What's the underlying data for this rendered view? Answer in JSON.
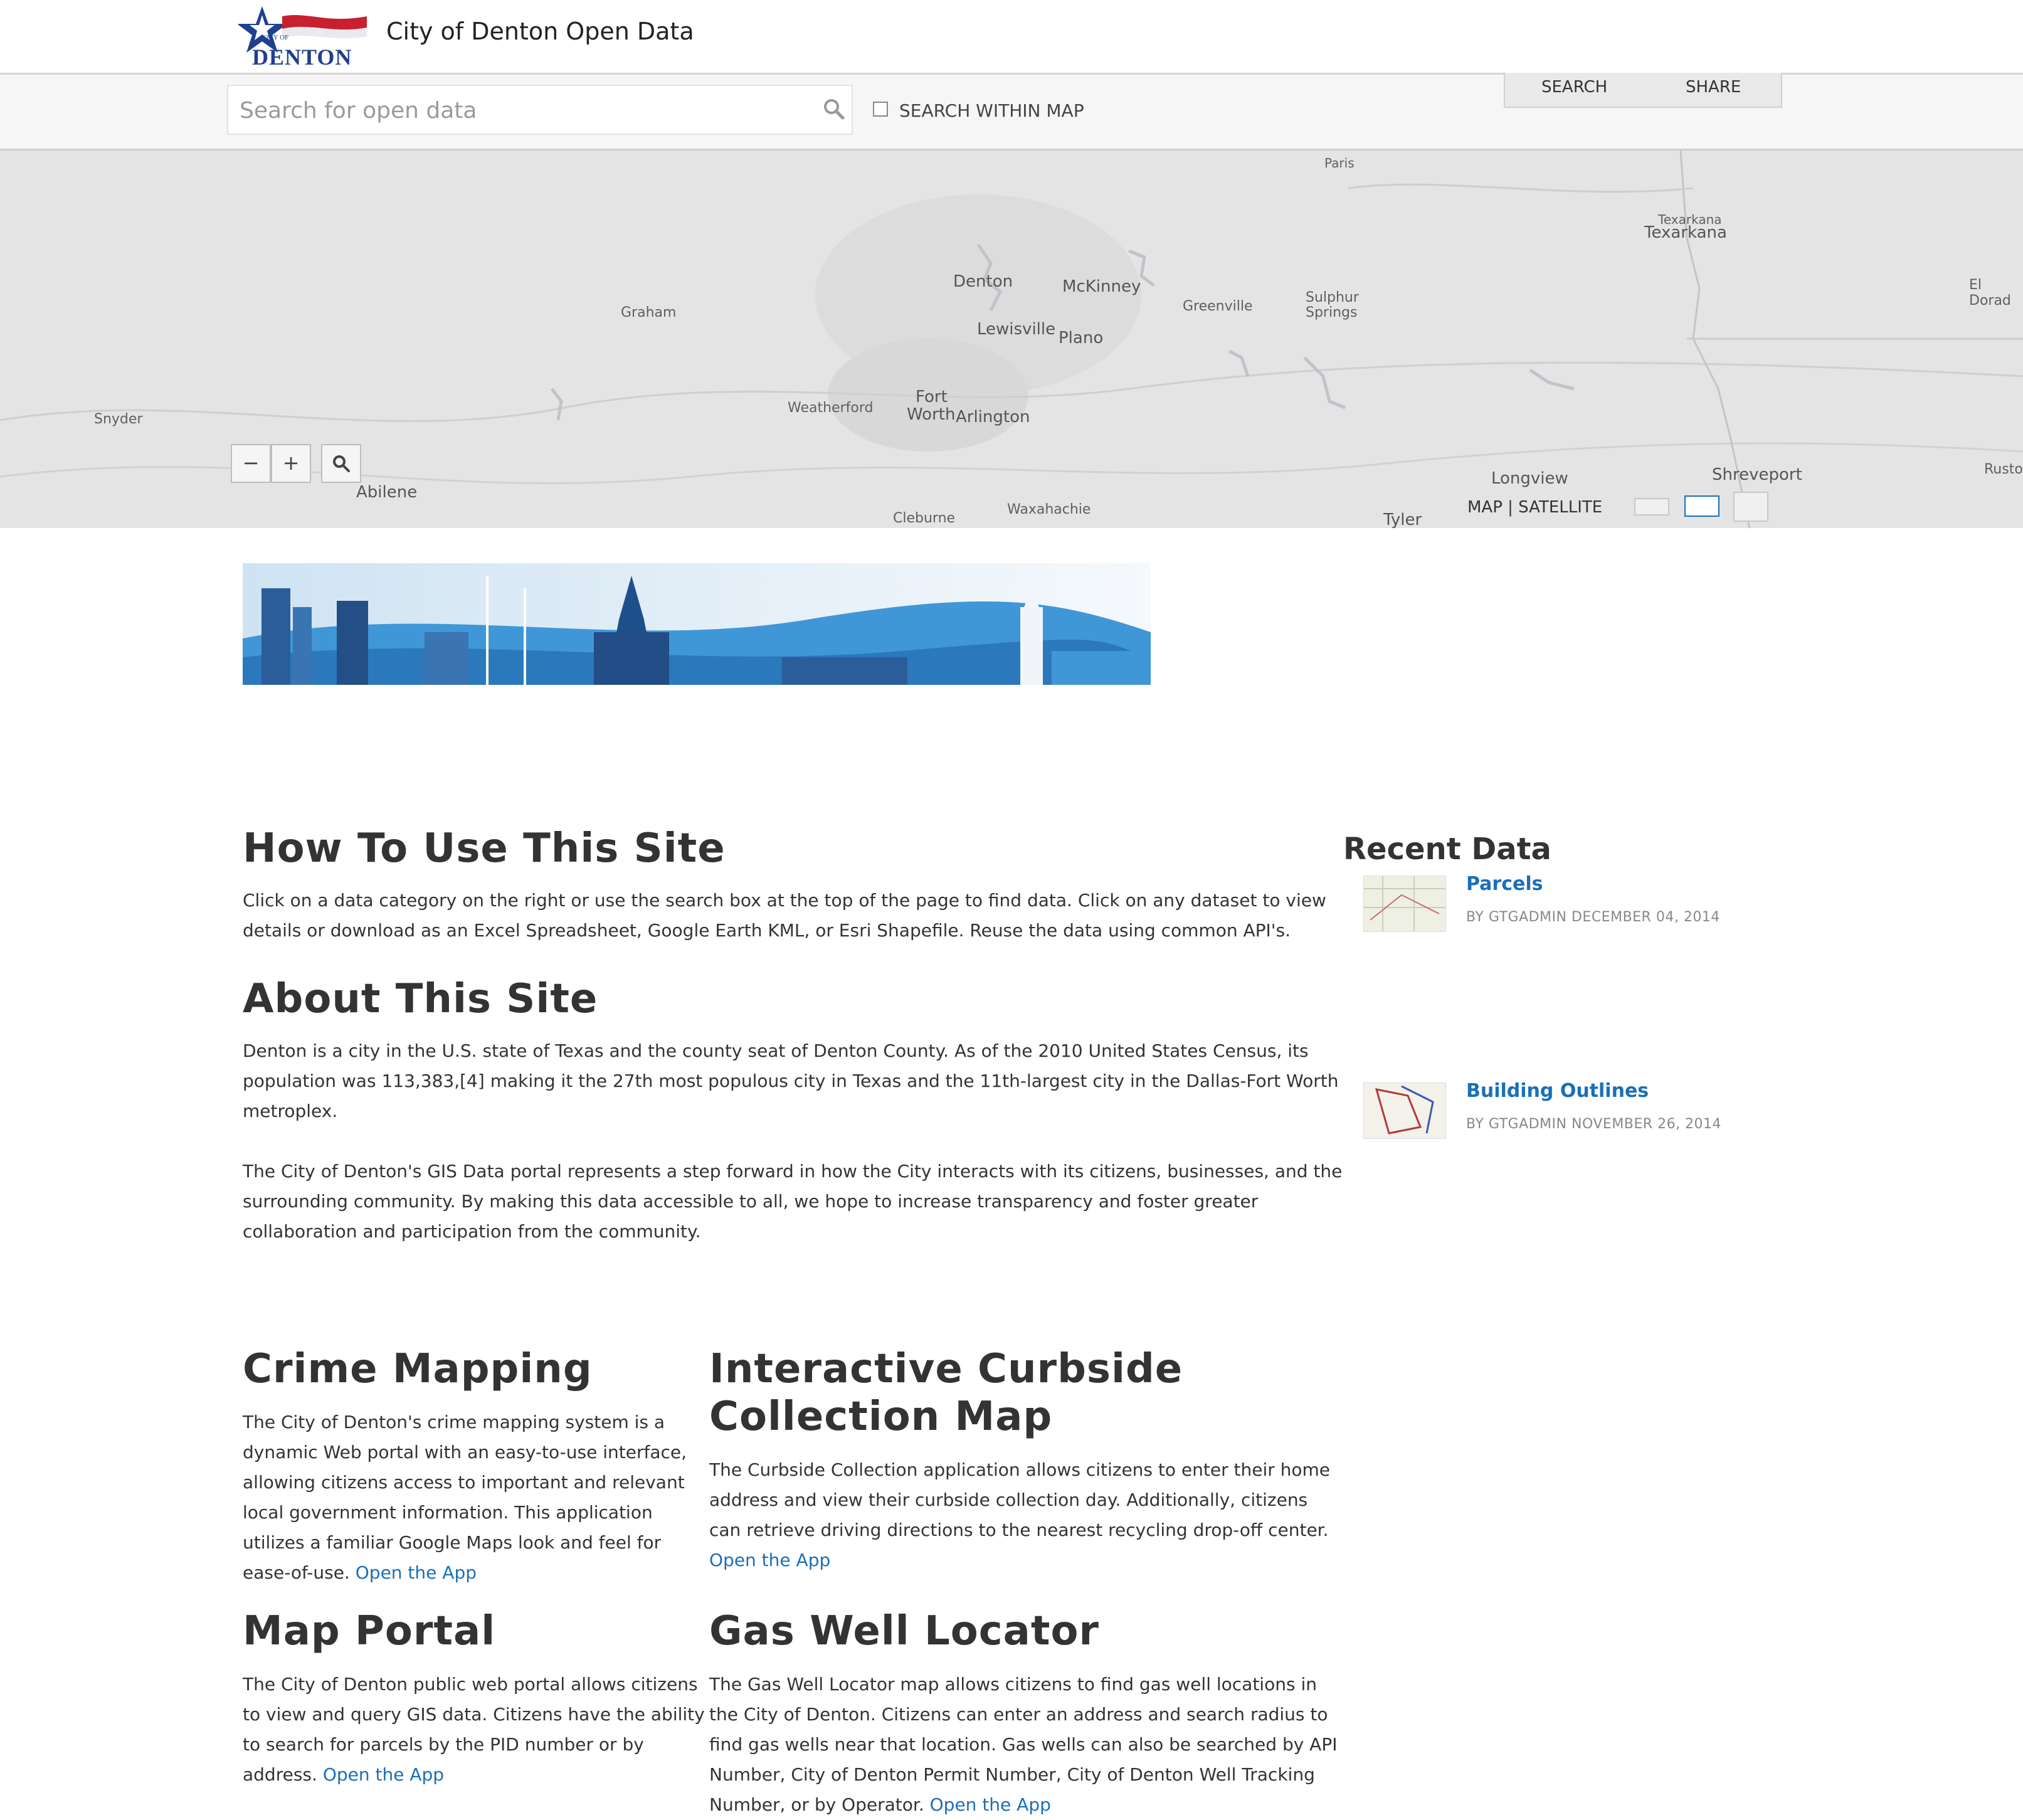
{
  "header": {
    "logo_text_top": "CITY OF",
    "logo_text": "DENTON",
    "site_title": "City of Denton Open Data"
  },
  "search": {
    "placeholder": "Search for open data",
    "within_map_label": "SEARCH WITHIN MAP",
    "within_map_checked": false
  },
  "tabs": {
    "search_label": "SEARCH",
    "share_label": "SHARE"
  },
  "map": {
    "cities": {
      "paris": "Paris",
      "texarkana1": "Texarkana",
      "texarkana2": "Texarkana",
      "el_dorado": "El Dorad",
      "denton": "Denton",
      "mckinney": "McKinney",
      "greenville": "Greenville",
      "sulphur_springs_1": "Sulphur",
      "sulphur_springs_2": "Springs",
      "graham": "Graham",
      "lewisville": "Lewisville",
      "plano": "Plano",
      "snyder": "Snyder",
      "weatherford": "Weatherford",
      "fort": "Fort",
      "worth": "Worth",
      "arlington": "Arlington",
      "abilene": "Abilene",
      "longview": "Longview",
      "shreveport": "Shreveport",
      "ruston": "Rusto",
      "cleburne": "Cleburne",
      "waxahachie": "Waxahachie",
      "tyler": "Tyler"
    },
    "zoom_out_label": "−",
    "zoom_in_label": "+",
    "basemap_toggle": "MAP | SATELLITE"
  },
  "content": {
    "how_title": "How To Use This Site",
    "how_line1": "Click on a data category on the right or use the search box at the top of the page to find data. Click on any dataset to view",
    "how_line2": "details or download as an Excel Spreadsheet, Google Earth KML, or Esri Shapefile. Reuse the data using common API's.",
    "about_title": "About This Site",
    "about_p1_l1": "Denton is a city in the U.S. state of Texas and the county seat of Denton County. As of the 2010 United States Census, its",
    "about_p1_l2": "population was 113,383,[4] making it the 27th most populous city in Texas and the 11th-largest city in the Dallas-Fort Worth",
    "about_p1_l3": "metroplex.",
    "about_p2_l1": "The City of Denton's GIS Data portal represents a step forward in how the City interacts with its citizens, businesses, and the",
    "about_p2_l2": "surrounding community. By making this data accessible to all, we hope to increase transparency and foster greater",
    "about_p2_l3": "collaboration and participation from the community."
  },
  "recent": {
    "title": "Recent Data",
    "items": [
      {
        "name": "Parcels",
        "meta": "BY GTGADMIN DECEMBER 04, 2014"
      },
      {
        "name": "Building Outlines",
        "meta": "BY GTGADMIN NOVEMBER 26, 2014"
      }
    ]
  },
  "apps": {
    "crime": {
      "title": "Crime Mapping",
      "l1": "The City of Denton's crime mapping system is a",
      "l2": "dynamic Web portal with an easy-to-use interface,",
      "l3": "allowing citizens access to important and relevant",
      "l4": "local government information. This application",
      "l5": "utilizes a familiar Google Maps look and feel for",
      "l6": "ease-of-use.",
      "link": "Open the App"
    },
    "curbside": {
      "title1": "Interactive Curbside",
      "title2": "Collection Map",
      "l1": "The Curbside Collection application allows citizens to enter their home",
      "l2": "address and view their curbside collection day. Additionally, citizens",
      "l3": "can retrieve driving directions to the nearest recycling drop-off center.",
      "link": "Open the App"
    },
    "portal": {
      "title": "Map Portal",
      "l1": "The City of Denton public web portal allows citizens",
      "l2": "to view and query GIS data. Citizens have the ability",
      "l3": "to search for parcels by the PID number or by",
      "l4": "address.",
      "link": "Open the App"
    },
    "gaswell": {
      "title": "Gas Well Locator",
      "l1": "The Gas Well Locator map allows citizens to find gas well locations in",
      "l2": "the City of Denton. Citizens can enter an address and search radius to",
      "l3": "find gas wells near that location. Gas wells can also be searched by API",
      "l4": "Number, City of Denton Permit Number, City of Denton Well Tracking",
      "l5": "Number, or by Operator.",
      "link": "Open the App"
    }
  },
  "colors": {
    "link": "#1a6fb8",
    "heading": "#333333",
    "map_bg": "#e4e4e4",
    "logo_blue": "#1f3f8f",
    "logo_red": "#c8202e"
  }
}
